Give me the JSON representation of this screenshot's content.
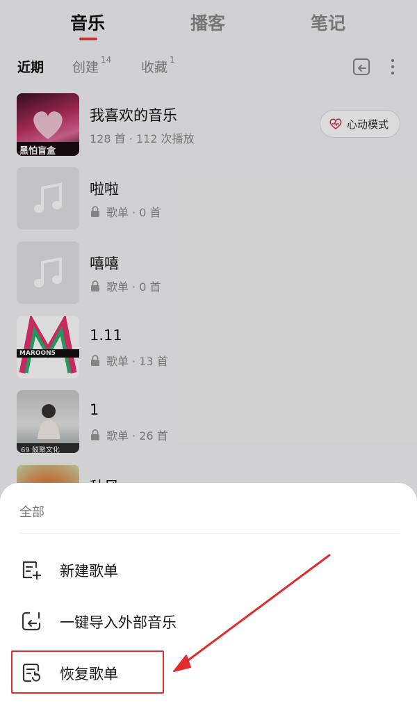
{
  "top_tabs": [
    {
      "label": "音乐",
      "active": true
    },
    {
      "label": "播客",
      "active": false
    },
    {
      "label": "笔记",
      "active": false
    }
  ],
  "sub_tabs": [
    {
      "label": "近期",
      "count": "",
      "active": true
    },
    {
      "label": "创建",
      "count": "14",
      "active": false
    },
    {
      "label": "收藏",
      "count": "1",
      "active": false
    }
  ],
  "playlists": [
    {
      "title": "我喜欢的音乐",
      "meta": "128 首 · 112 次播放",
      "cover": "liked-cover",
      "cover_text": "黑怕盲盒",
      "locked": false
    },
    {
      "title": "啦啦",
      "meta": "歌单 · 0 首",
      "cover": "placeholder-music",
      "locked": true
    },
    {
      "title": "嘻嘻",
      "meta": "歌单 · 0 首",
      "cover": "placeholder-music",
      "locked": true
    },
    {
      "title": "1.11",
      "meta": "歌单 · 13 首",
      "cover": "maroon5-cover",
      "cover_text": "MAROON5",
      "locked": true
    },
    {
      "title": "1",
      "meta": "歌单 · 26 首",
      "cover": "photo-cover",
      "cover_text": "69 鼓聚文化",
      "locked": true
    },
    {
      "title": "秋风",
      "meta": "",
      "cover": "orange-cover",
      "locked": false
    }
  ],
  "heart_mode_button": {
    "label": "心动模式",
    "icon": "heart-pulse-icon"
  },
  "sheet": {
    "header": "全部",
    "items": [
      {
        "label": "新建歌单",
        "icon": "new-playlist-icon"
      },
      {
        "label": "一键导入外部音乐",
        "icon": "import-icon"
      },
      {
        "label": "恢复歌单",
        "icon": "restore-playlist-icon"
      }
    ]
  },
  "colors": {
    "accent": "#e33a44",
    "annotation": "#e32b2b"
  }
}
